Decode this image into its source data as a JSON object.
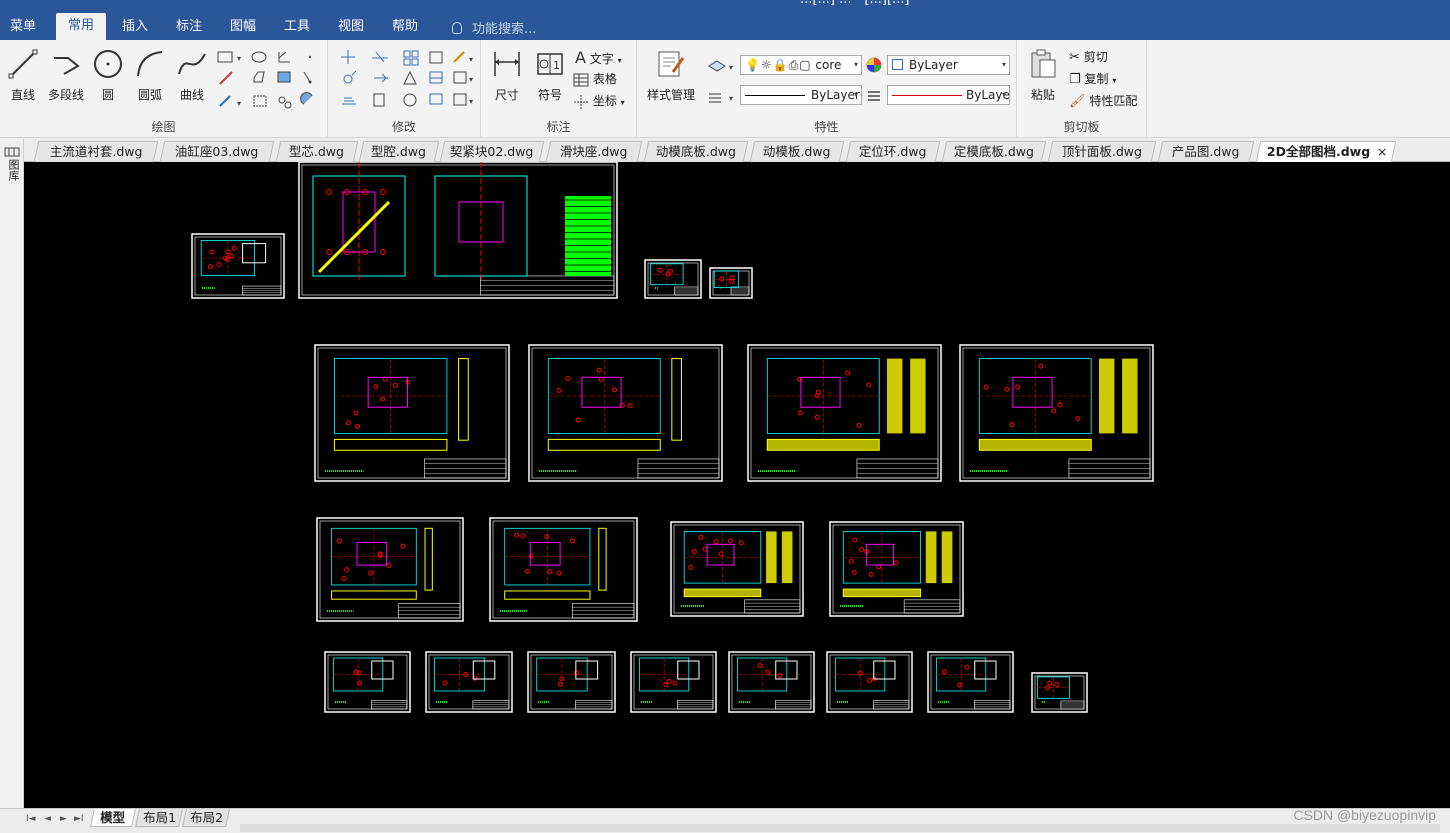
{
  "menu": {
    "tabs": [
      "菜单",
      "常用",
      "插入",
      "标注",
      "图幅",
      "工具",
      "视图",
      "帮助"
    ],
    "active_tab": "常用",
    "search_placeholder": "功能搜索...",
    "title_fragment": "...[...] ... - [...][...]"
  },
  "ribbon": {
    "draw": {
      "label": "绘图",
      "line": "直线",
      "polyline": "多段线",
      "circle": "圆",
      "arc": "圆弧",
      "curve": "曲线"
    },
    "modify": {
      "label": "修改"
    },
    "annotate": {
      "label": "标注",
      "dimension": "尺寸",
      "symbol": "符号",
      "text": "文字",
      "table": "表格",
      "coordinate": "坐标"
    },
    "properties": {
      "label": "特性",
      "style_manager": "样式管理",
      "linetype_value": "core",
      "color_value": "ByLayer",
      "line_value": "ByLayer",
      "line_value2": "ByLaye"
    },
    "clipboard": {
      "label": "剪切板",
      "paste": "粘贴",
      "cut": "剪切",
      "copy": "复制",
      "match": "特性匹配"
    }
  },
  "doc_tabs": [
    "主流道衬套.dwg",
    "油缸座03.dwg",
    "型芯.dwg",
    "型腔.dwg",
    "契紧块02.dwg",
    "滑块座.dwg",
    "动模底板.dwg",
    "动模板.dwg",
    "定位环.dwg",
    "定模底板.dwg",
    "顶针面板.dwg",
    "产品图.dwg",
    "2D全部图档.dwg"
  ],
  "active_doc": "2D全部图档.dwg",
  "close_glyph": "×",
  "left_strip_label": "图库",
  "layout_tabs": [
    "模型",
    "布局1",
    "布局2"
  ],
  "active_layout": "模型",
  "nav_glyphs": [
    "I◄",
    "◄",
    "►",
    "►I"
  ],
  "watermark": "CSDN @biyezuopinvip",
  "colors": {
    "menubar": "#2b579a",
    "canvas": "#000000",
    "drawing_white": "#ffffff",
    "drawing_green": "#00ff00",
    "drawing_yellow": "#ffff00",
    "drawing_cyan": "#00ffff",
    "drawing_magenta": "#ff00ff",
    "drawing_red": "#ff0000"
  }
}
